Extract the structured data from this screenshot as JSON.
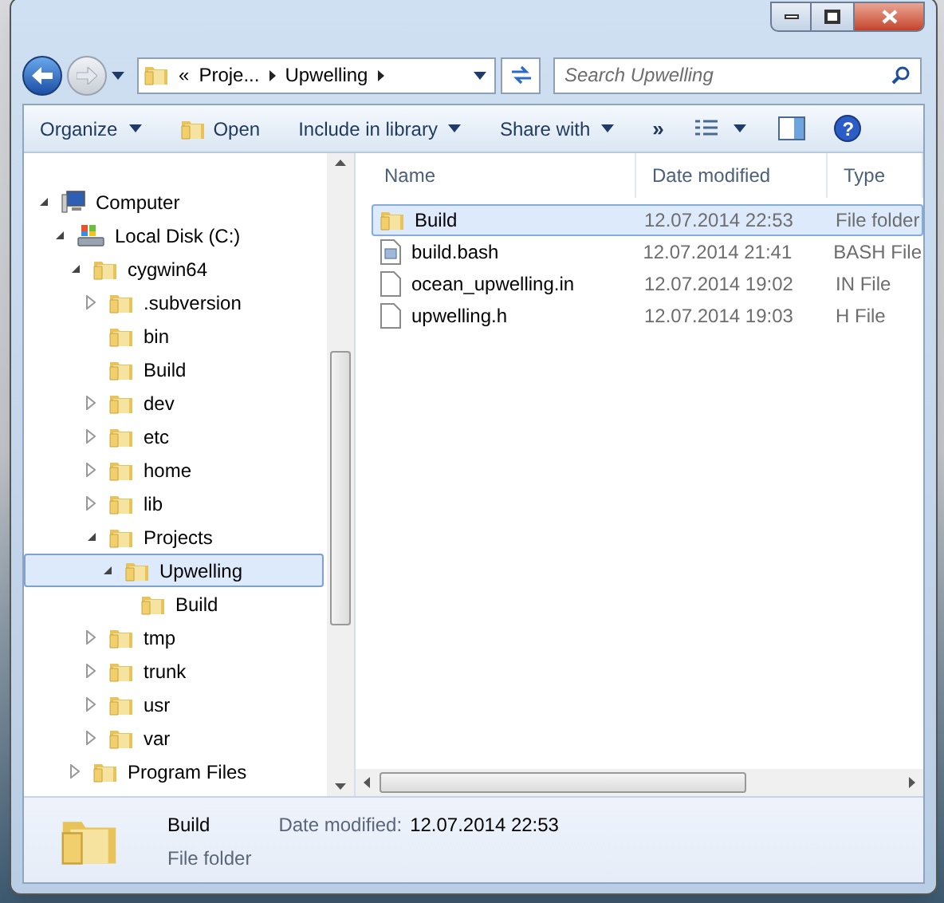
{
  "address_bar": {
    "overflow": "«",
    "segments": [
      "Proje...",
      "Upwelling"
    ]
  },
  "search": {
    "placeholder": "Search Upwelling"
  },
  "toolbar": {
    "items": [
      {
        "label": "Organize",
        "kind": "menu"
      },
      {
        "label": "Open",
        "kind": "open"
      },
      {
        "label": "Include in library",
        "kind": "menu"
      },
      {
        "label": "Share with",
        "kind": "menu"
      },
      {
        "label": "»",
        "kind": "more"
      }
    ]
  },
  "tree": [
    {
      "label": "Computer",
      "kind": "computer",
      "expanded": true,
      "selected": false,
      "children": [
        {
          "label": "Local Disk (C:)",
          "kind": "disk",
          "expanded": true,
          "selected": false,
          "children": [
            {
              "label": "cygwin64",
              "kind": "folder",
              "expanded": true,
              "selected": false,
              "children": [
                {
                  "label": ".subversion",
                  "kind": "folder",
                  "expanded": false,
                  "selected": false
                },
                {
                  "label": "bin",
                  "kind": "folder",
                  "selected": false
                },
                {
                  "label": "Build",
                  "kind": "folder",
                  "selected": false
                },
                {
                  "label": "dev",
                  "kind": "folder",
                  "expanded": false,
                  "selected": false
                },
                {
                  "label": "etc",
                  "kind": "folder",
                  "expanded": false,
                  "selected": false
                },
                {
                  "label": "home",
                  "kind": "folder",
                  "expanded": false,
                  "selected": false
                },
                {
                  "label": "lib",
                  "kind": "folder",
                  "expanded": false,
                  "selected": false
                },
                {
                  "label": "Projects",
                  "kind": "folder",
                  "expanded": true,
                  "selected": false,
                  "children": [
                    {
                      "label": "Upwelling",
                      "kind": "folder",
                      "expanded": true,
                      "selected": true,
                      "children": [
                        {
                          "label": "Build",
                          "kind": "folder",
                          "selected": false
                        }
                      ]
                    }
                  ]
                },
                {
                  "label": "tmp",
                  "kind": "folder",
                  "expanded": false,
                  "selected": false
                },
                {
                  "label": "trunk",
                  "kind": "folder",
                  "expanded": false,
                  "selected": false
                },
                {
                  "label": "usr",
                  "kind": "folder",
                  "expanded": false,
                  "selected": false
                },
                {
                  "label": "var",
                  "kind": "folder",
                  "expanded": false,
                  "selected": false
                }
              ]
            },
            {
              "label": "Program Files",
              "kind": "folder",
              "expanded": false,
              "selected": false
            }
          ]
        }
      ]
    }
  ],
  "file_list": {
    "columns": [
      "Name",
      "Date modified",
      "Type"
    ],
    "rows": [
      {
        "name": "Build",
        "date": "12.07.2014 22:53",
        "type": "File folder",
        "kind": "folder",
        "selected": true
      },
      {
        "name": "build.bash",
        "date": "12.07.2014 21:41",
        "type": "BASH File",
        "kind": "script",
        "selected": false
      },
      {
        "name": "ocean_upwelling.in",
        "date": "12.07.2014 19:02",
        "type": "IN File",
        "kind": "file",
        "selected": false
      },
      {
        "name": "upwelling.h",
        "date": "12.07.2014 19:03",
        "type": "H File",
        "kind": "file",
        "selected": false
      }
    ]
  },
  "help_button": {
    "label": "?"
  },
  "details": {
    "name": "Build",
    "type": "File folder",
    "date_label": "Date modified:",
    "date": "12.07.2014 22:53"
  }
}
